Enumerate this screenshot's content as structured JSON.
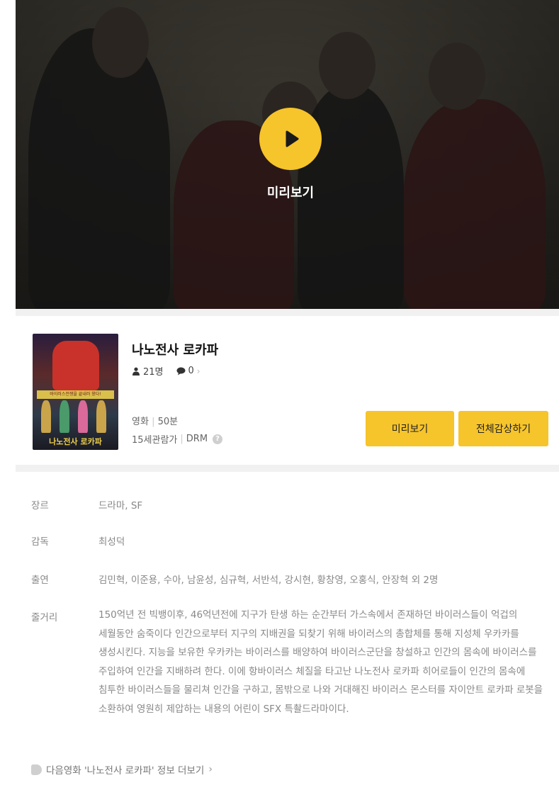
{
  "hero": {
    "play_label": "미리보기"
  },
  "movie": {
    "title": "나노전사 로카파",
    "viewers": "21명",
    "comments": "0",
    "type": "영화",
    "duration": "50분",
    "rating": "15세관람가",
    "drm": "DRM",
    "poster_banner": "바이러스전쟁을 끝내러 왔다!",
    "poster_title": "나노전사 로카파"
  },
  "buttons": {
    "preview": "미리보기",
    "watch_full": "전체감상하기"
  },
  "details": {
    "genre_label": "장르",
    "genre": "드라마, SF",
    "director_label": "감독",
    "director": "최성덕",
    "cast_label": "출연",
    "cast": "김민혁, 이준용, 수아, 남윤성, 심규혁, 서반석, 강시현, 황창영, 오홍식, 안장혁 외 2명",
    "plot_label": "줄거리",
    "plot": "150억년 전 빅뱅이후, 46억년전에 지구가 탄생 하는 순간부터 가스속에서 존재하던 바이러스들이 억겁의 세월동안 숨죽이다 인간으로부터 지구의 지배권을 되찾기 위해 바이러스의 총합체를 통해 지성체 우카카를 생성시킨다. 지능을 보유한 우카카는 바이러스를 배양하여 바이러스군단을 창설하고 인간의 몸속에 바이러스를 주입하여 인간을 지배하려 한다. 이에 항바이러스 체질을 타고난 나노전사 로카파 히어로들이 인간의 몸속에 침투한 바이러스들을 물리쳐 인간을 구하고, 몸밖으로 나와 거대해진 바이러스 몬스터를 자이안트 로카파 로봇을 소환하여 영원히 제압하는 내용의 어린이 SFX 특촬드라마이다."
  },
  "more_link": "다음영화 '나노전사 로카파' 정보 더보기",
  "colors": {
    "accent": "#f6c42b",
    "label_gray": "#888888"
  }
}
